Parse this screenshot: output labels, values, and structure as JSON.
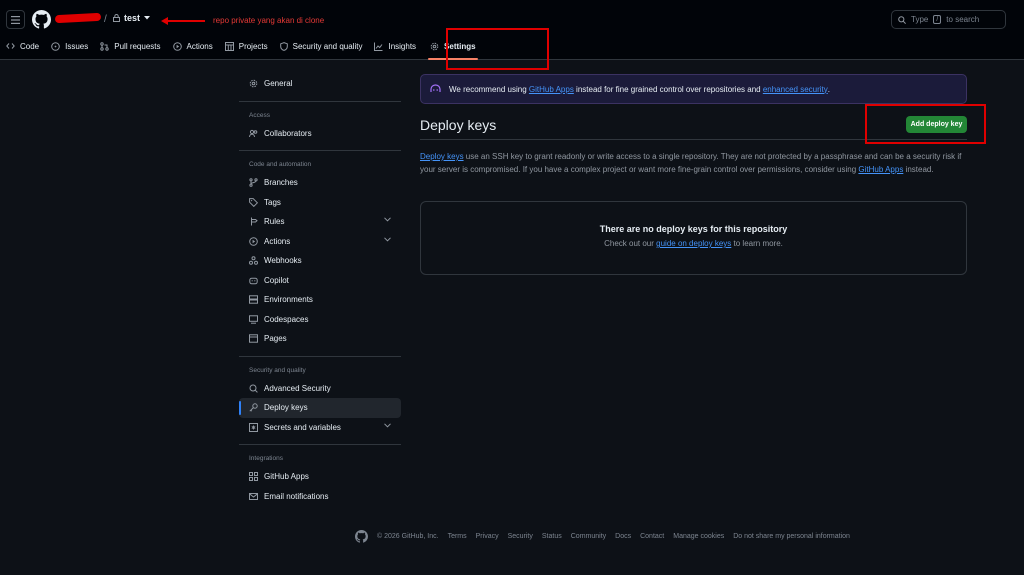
{
  "header": {
    "repo_name": "test",
    "annotation": "repo private yang akan di clone",
    "search_text": "Type",
    "search_key": "/",
    "search_suffix": "to search"
  },
  "tabs": [
    {
      "label": "Code",
      "icon": "code-icon"
    },
    {
      "label": "Issues",
      "icon": "issue-icon"
    },
    {
      "label": "Pull requests",
      "icon": "pull-request-icon"
    },
    {
      "label": "Actions",
      "icon": "play-icon"
    },
    {
      "label": "Projects",
      "icon": "table-icon"
    },
    {
      "label": "Security and quality",
      "icon": "shield-icon"
    },
    {
      "label": "Insights",
      "icon": "graph-icon"
    },
    {
      "label": "Settings",
      "icon": "gear-icon"
    }
  ],
  "sidebar": {
    "general": "General",
    "group_access": "Access",
    "collaborators": "Collaborators",
    "group_code": "Code and automation",
    "branches": "Branches",
    "tags": "Tags",
    "rules": "Rules",
    "actions": "Actions",
    "webhooks": "Webhooks",
    "copilot": "Copilot",
    "environments": "Environments",
    "codespaces": "Codespaces",
    "pages": "Pages",
    "group_security": "Security and quality",
    "advanced_security": "Advanced Security",
    "deploy_keys": "Deploy keys",
    "secrets": "Secrets and variables",
    "group_integrations": "Integrations",
    "github_apps": "GitHub Apps",
    "email": "Email notifications"
  },
  "banner": {
    "pre": "We recommend using ",
    "link1": "GitHub Apps",
    "mid": " instead for fine grained control over repositories and ",
    "link2": "enhanced security",
    "post": "."
  },
  "main": {
    "title": "Deploy keys",
    "add_button": "Add deploy key",
    "desc_link": "Deploy keys",
    "desc_text": " use an SSH key to grant readonly or write access to a single repository. They are not protected by a passphrase and can be a security risk if your server is compromised. If you have a complex project or want more fine-grain control over permissions, consider using ",
    "desc_link2": "GitHub Apps",
    "desc_end": " instead.",
    "empty_title": "There are no deploy keys for this repository",
    "empty_pre": "Check out our ",
    "empty_link": "guide on deploy keys",
    "empty_post": " to learn more."
  },
  "footer": {
    "copyright": "© 2026 GitHub, Inc.",
    "links": [
      "Terms",
      "Privacy",
      "Security",
      "Status",
      "Community",
      "Docs",
      "Contact",
      "Manage cookies",
      "Do not share my personal information"
    ]
  },
  "colors": {
    "accent_green": "#238636",
    "link": "#4493f8",
    "annotation_red": "#e00000"
  }
}
